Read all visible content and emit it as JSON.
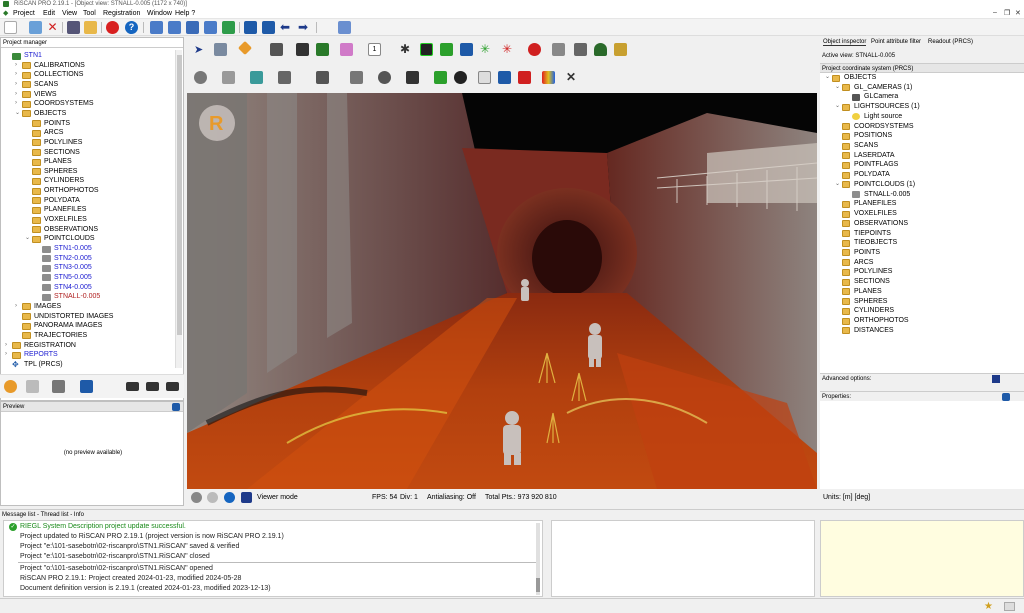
{
  "window": {
    "title": "RiSCAN PRO 2.19.1 - [Object view: STNALL-0.005 (1172 x 740)]"
  },
  "menu": [
    "Project",
    "Edit",
    "View",
    "Tool",
    "Registration",
    "Window",
    "Help ?"
  ],
  "project_manager": {
    "header": "Project manager",
    "tree": [
      {
        "label": "STN1",
        "depth": 0,
        "exp": "",
        "icon": "project",
        "color": "blue"
      },
      {
        "label": "CALIBRATIONS",
        "depth": 1,
        "exp": ">",
        "icon": "folder"
      },
      {
        "label": "COLLECTIONS",
        "depth": 1,
        "exp": ">",
        "icon": "folder"
      },
      {
        "label": "SCANS",
        "depth": 1,
        "exp": ">",
        "icon": "folder"
      },
      {
        "label": "VIEWS",
        "depth": 1,
        "exp": ">",
        "icon": "folder"
      },
      {
        "label": "COORDSYSTEMS",
        "depth": 1,
        "exp": ">",
        "icon": "folder"
      },
      {
        "label": "OBJECTS",
        "depth": 1,
        "exp": "v",
        "icon": "folder"
      },
      {
        "label": "POINTS",
        "depth": 2,
        "exp": "",
        "icon": "folder"
      },
      {
        "label": "ARCS",
        "depth": 2,
        "exp": "",
        "icon": "folder"
      },
      {
        "label": "POLYLINES",
        "depth": 2,
        "exp": "",
        "icon": "folder"
      },
      {
        "label": "SECTIONS",
        "depth": 2,
        "exp": "",
        "icon": "folder"
      },
      {
        "label": "PLANES",
        "depth": 2,
        "exp": "",
        "icon": "folder"
      },
      {
        "label": "SPHERES",
        "depth": 2,
        "exp": "",
        "icon": "folder"
      },
      {
        "label": "CYLINDERS",
        "depth": 2,
        "exp": "",
        "icon": "folder"
      },
      {
        "label": "ORTHOPHOTOS",
        "depth": 2,
        "exp": "",
        "icon": "folder"
      },
      {
        "label": "POLYDATA",
        "depth": 2,
        "exp": "",
        "icon": "folder"
      },
      {
        "label": "PLANEFILES",
        "depth": 2,
        "exp": "",
        "icon": "folder"
      },
      {
        "label": "VOXELFILES",
        "depth": 2,
        "exp": "",
        "icon": "folder"
      },
      {
        "label": "OBSERVATIONS",
        "depth": 2,
        "exp": "",
        "icon": "folder"
      },
      {
        "label": "POINTCLOUDS",
        "depth": 2,
        "exp": "v",
        "icon": "folder"
      },
      {
        "label": "STN1-0.005",
        "depth": 3,
        "exp": "",
        "icon": "cloud",
        "color": "blue"
      },
      {
        "label": "STN2-0.005",
        "depth": 3,
        "exp": "",
        "icon": "cloud",
        "color": "blue"
      },
      {
        "label": "STN3-0.005",
        "depth": 3,
        "exp": "",
        "icon": "cloud",
        "color": "blue"
      },
      {
        "label": "STN5-0.005",
        "depth": 3,
        "exp": "",
        "icon": "cloud",
        "color": "blue"
      },
      {
        "label": "STN4-0.005",
        "depth": 3,
        "exp": "",
        "icon": "cloud",
        "color": "blue"
      },
      {
        "label": "STNALL-0.005",
        "depth": 3,
        "exp": "",
        "icon": "cloud",
        "color": "red"
      },
      {
        "label": "IMAGES",
        "depth": 1,
        "exp": ">",
        "icon": "folder"
      },
      {
        "label": "UNDISTORTED IMAGES",
        "depth": 1,
        "exp": "",
        "icon": "folder"
      },
      {
        "label": "PANORAMA IMAGES",
        "depth": 1,
        "exp": "",
        "icon": "folder"
      },
      {
        "label": "TRAJECTORIES",
        "depth": 1,
        "exp": "",
        "icon": "folder"
      },
      {
        "label": "REGISTRATION",
        "depth": 0,
        "exp": ">",
        "icon": "folder"
      },
      {
        "label": "REPORTS",
        "depth": 0,
        "exp": ">",
        "icon": "folder",
        "color": "blue"
      },
      {
        "label": "TPL (PRCS)",
        "depth": 0,
        "exp": "",
        "icon": "axes"
      }
    ]
  },
  "preview": {
    "header": "Preview",
    "empty_text": "(no preview available)"
  },
  "view_status": {
    "mode": "Viewer mode",
    "fps": "FPS: 54",
    "div": "Div: 1",
    "aa": "Antialiasing: Off",
    "total": "Total Pts.:  973 920 810"
  },
  "right_panel": {
    "tabs": [
      "Object inspector",
      "Point attribute filter",
      "Readout (PRCS)"
    ],
    "active_view": "Active view: STNALL-0.005",
    "pcs_header": "Project coordinate system (PRCS)",
    "tree": [
      {
        "label": "OBJECTS",
        "depth": 0,
        "exp": "v",
        "icon": "folder"
      },
      {
        "label": "GL_CAMERAS (1)",
        "depth": 1,
        "exp": "v",
        "icon": "folder"
      },
      {
        "label": "GLCamera",
        "depth": 2,
        "exp": "",
        "icon": "camera"
      },
      {
        "label": "LIGHTSOURCES (1)",
        "depth": 1,
        "exp": "v",
        "icon": "folder"
      },
      {
        "label": "Light source",
        "depth": 2,
        "exp": "",
        "icon": "bulb"
      },
      {
        "label": "COORDSYSTEMS",
        "depth": 1,
        "exp": "",
        "icon": "folder"
      },
      {
        "label": "POSITIONS",
        "depth": 1,
        "exp": "",
        "icon": "folder"
      },
      {
        "label": "SCANS",
        "depth": 1,
        "exp": "",
        "icon": "folder"
      },
      {
        "label": "LASERDATA",
        "depth": 1,
        "exp": "",
        "icon": "folder"
      },
      {
        "label": "POINTFLAGS",
        "depth": 1,
        "exp": "",
        "icon": "folder"
      },
      {
        "label": "POLYDATA",
        "depth": 1,
        "exp": "",
        "icon": "folder"
      },
      {
        "label": "POINTCLOUDS (1)",
        "depth": 1,
        "exp": "v",
        "icon": "folder"
      },
      {
        "label": "STNALL-0.005",
        "depth": 2,
        "exp": "",
        "icon": "cloud"
      },
      {
        "label": "PLANEFILES",
        "depth": 1,
        "exp": "",
        "icon": "folder"
      },
      {
        "label": "VOXELFILES",
        "depth": 1,
        "exp": "",
        "icon": "folder"
      },
      {
        "label": "OBSERVATIONS",
        "depth": 1,
        "exp": "",
        "icon": "folder"
      },
      {
        "label": "TIEPOINTS",
        "depth": 1,
        "exp": "",
        "icon": "folder"
      },
      {
        "label": "TIEOBJECTS",
        "depth": 1,
        "exp": "",
        "icon": "folder"
      },
      {
        "label": "POINTS",
        "depth": 1,
        "exp": "",
        "icon": "folder"
      },
      {
        "label": "ARCS",
        "depth": 1,
        "exp": "",
        "icon": "folder"
      },
      {
        "label": "POLYLINES",
        "depth": 1,
        "exp": "",
        "icon": "folder"
      },
      {
        "label": "SECTIONS",
        "depth": 1,
        "exp": "",
        "icon": "folder"
      },
      {
        "label": "PLANES",
        "depth": 1,
        "exp": "",
        "icon": "folder"
      },
      {
        "label": "SPHERES",
        "depth": 1,
        "exp": "",
        "icon": "folder"
      },
      {
        "label": "CYLINDERS",
        "depth": 1,
        "exp": "",
        "icon": "folder"
      },
      {
        "label": "ORTHOPHOTOS",
        "depth": 1,
        "exp": "",
        "icon": "folder"
      },
      {
        "label": "DISTANCES",
        "depth": 1,
        "exp": "",
        "icon": "folder"
      }
    ],
    "advanced": "Advanced options:",
    "properties": "Properties:",
    "units": "Units: [m] [deg]"
  },
  "messages": {
    "header": "Message list - Thread list - Info",
    "lines": [
      "RIEGL System Description project update successful.",
      "Project updated to RiSCAN PRO 2.19.1 (project version is now RiSCAN PRO 2.19.1)",
      "Project \"e:\\101-sasebotn\\02-riscanpro\\STN1.RiSCAN\" saved & verified",
      "Project \"e:\\101-sasebotn\\02-riscanpro\\STN1.RiSCAN\" closed",
      "Project \"o:\\101-sasebotn\\02-riscanpro\\STN1.RiSCAN\" opened",
      "RiSCAN PRO 2.19.1: Project created 2024-01-23, modified 2024-05-28",
      "Document definition version is 2.19.1 (created 2024-01-23, modified 2023-12-13)"
    ]
  },
  "colors": {
    "accent": "#1a1ad0",
    "highlight": "#b02020",
    "folder": "#e8b84a",
    "success": "#2ca02c"
  }
}
